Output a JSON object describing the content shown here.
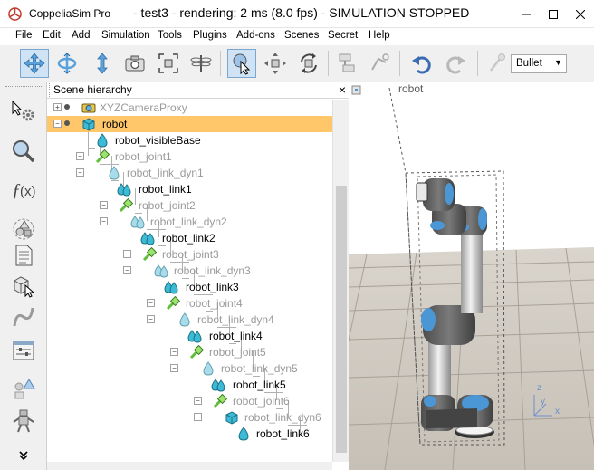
{
  "window": {
    "app_name": "CoppeliaSim Pro",
    "document_title": "- test3 - rendering: 2 ms (8.0 fps) - SIMULATION STOPPED"
  },
  "menu": {
    "items": [
      "File",
      "Edit",
      "Add",
      "Simulation",
      "Tools",
      "Plugins",
      "Add-ons",
      "Scenes",
      "Secret",
      "Help"
    ]
  },
  "toolbar": {
    "engine_select_value": "Bullet"
  },
  "scene_hierarchy": {
    "title": "Scene hierarchy",
    "close_label": "×",
    "items": [
      {
        "label": "XYZCameraProxy",
        "icon": "camera-icon",
        "dim": true
      },
      {
        "label": "robot",
        "icon": "cube-icon",
        "dim": false,
        "selected": true
      },
      {
        "label": "robot_visibleBase",
        "icon": "shape-icon",
        "dim": false
      },
      {
        "label": "robot_joint1",
        "icon": "joint-icon",
        "dim": true
      },
      {
        "label": "robot_link_dyn1",
        "icon": "shape-icon",
        "dim": true
      },
      {
        "label": "robot_link1",
        "icon": "multishape-icon",
        "dim": false
      },
      {
        "label": "robot_joint2",
        "icon": "joint-icon",
        "dim": true
      },
      {
        "label": "robot_link_dyn2",
        "icon": "multishape-icon",
        "dim": true
      },
      {
        "label": "robot_link2",
        "icon": "multishape-icon",
        "dim": false
      },
      {
        "label": "robot_joint3",
        "icon": "joint-icon",
        "dim": true
      },
      {
        "label": "robot_link_dyn3",
        "icon": "multishape-icon",
        "dim": true
      },
      {
        "label": "robot_link3",
        "icon": "multishape-icon",
        "dim": false
      },
      {
        "label": "robot_joint4",
        "icon": "joint-icon",
        "dim": true
      },
      {
        "label": "robot_link_dyn4",
        "icon": "shape-icon",
        "dim": true
      },
      {
        "label": "robot_link4",
        "icon": "multishape-icon",
        "dim": false
      },
      {
        "label": "robot_joint5",
        "icon": "joint-icon",
        "dim": true
      },
      {
        "label": "robot_link_dyn5",
        "icon": "shape-icon",
        "dim": true
      },
      {
        "label": "robot_link5",
        "icon": "multishape-icon",
        "dim": false
      },
      {
        "label": "robot_joint6",
        "icon": "joint-icon",
        "dim": true
      },
      {
        "label": "robot_link_dyn6",
        "icon": "cube-icon",
        "dim": true
      },
      {
        "label": "robot_link6",
        "icon": "shape-icon",
        "dim": false
      }
    ]
  },
  "viewport": {
    "object_label": "robot",
    "axis_labels": {
      "z": "z",
      "y": "y",
      "x": "x"
    }
  },
  "colors": {
    "selection": "#ffc76a",
    "accent_blue": "#4b97d6",
    "shape_cyan": "#3dbad6",
    "joint_green": "#5fbf3a"
  }
}
